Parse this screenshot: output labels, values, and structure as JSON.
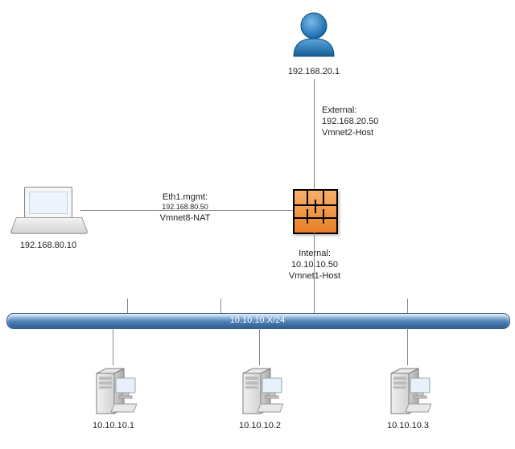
{
  "user": {
    "ip": "192.168.20.1"
  },
  "external_if": {
    "title": "External:",
    "ip": "192.168.20.50",
    "net": "Vmnet2-Host"
  },
  "mgmt_if": {
    "title": "Eth1.mgmt:",
    "ip": "192.168.80.50",
    "net": "Vmnet8-NAT"
  },
  "laptop": {
    "ip": "192.168.80.10"
  },
  "internal_if": {
    "title": "Internal:",
    "ip": "10.10.10.50",
    "net": "Vmnet1-Host"
  },
  "bus": {
    "cidr": "10.10.10.X/24"
  },
  "servers": {
    "s1": "10.10.10.1",
    "s2": "10.10.10.2",
    "s3": "10.10.10.3"
  }
}
